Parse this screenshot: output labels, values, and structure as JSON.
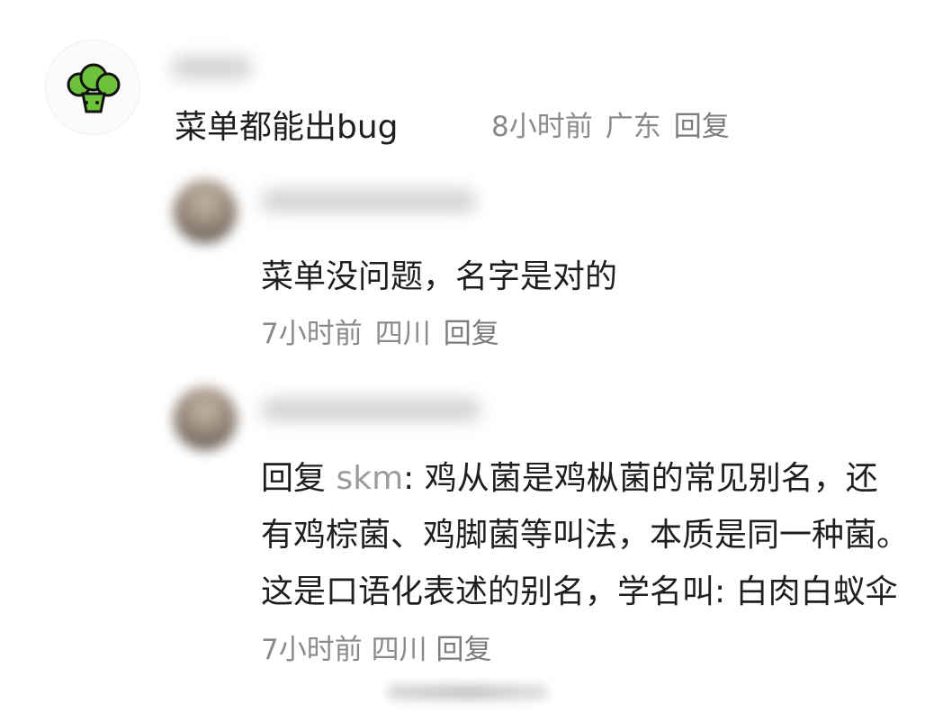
{
  "comment": {
    "username": "skm",
    "text": "菜单都能出bug",
    "time": "8小时前",
    "location": "广东",
    "reply_label": "回复",
    "avatar_icon": "broccoli-icon",
    "avatar_color": "#66c033"
  },
  "replies": [
    {
      "text": "菜单没问题，名字是对的",
      "time": "7小时前",
      "location": "四川",
      "reply_label": "回复"
    },
    {
      "prefix": "回复",
      "mention": "skm",
      "colon": ":",
      "text": "鸡从菌是鸡枞菌的常见别名，还有鸡棕菌、鸡脚菌等叫法，本质是同一种菌。这是口语化表述的别名，学名叫: 白肉白蚁伞",
      "time": "7小时前",
      "location": "四川",
      "reply_label": "回复"
    }
  ]
}
